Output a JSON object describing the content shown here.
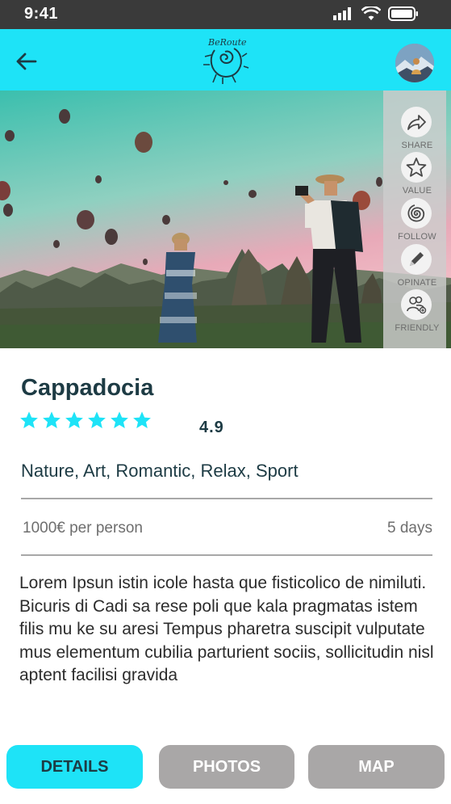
{
  "status_bar": {
    "time": "9:41"
  },
  "header": {
    "back_icon": "arrow-left-icon",
    "logo_text": "BeRoute",
    "avatar": "user-avatar"
  },
  "actions": [
    {
      "label": "SHARE",
      "icon": "share-arrow-icon"
    },
    {
      "label": "VALUE",
      "icon": "star-outline-icon"
    },
    {
      "label": "FOLLOW",
      "icon": "spiral-icon"
    },
    {
      "label": "OPINATE",
      "icon": "pencil-icon"
    },
    {
      "label": "FRIENDLY",
      "icon": "people-add-icon"
    }
  ],
  "place": {
    "title": "Cappadocia",
    "stars": 6,
    "rating": "4.9",
    "tags": "Nature, Art, Romantic, Relax, Sport",
    "price": "1000€ per person",
    "duration": "5 days",
    "description": "Lorem Ipsun istin icole hasta que fisticolico de nimiluti. Bicuris di Cadi sa rese poli que kala pragmatas istem filis mu ke su aresi Tempus pharetra suscipit vulputate mus elementum cubilia parturient sociis, sollicitudin nisl aptent facilisi gravida"
  },
  "tabs": {
    "details": "DETAILS",
    "photos": "PHOTOS",
    "map": "MAP"
  },
  "colors": {
    "accent": "#1ee3f7",
    "dark_text": "#1d3b44",
    "inactive_tab": "#a9a7a7"
  }
}
